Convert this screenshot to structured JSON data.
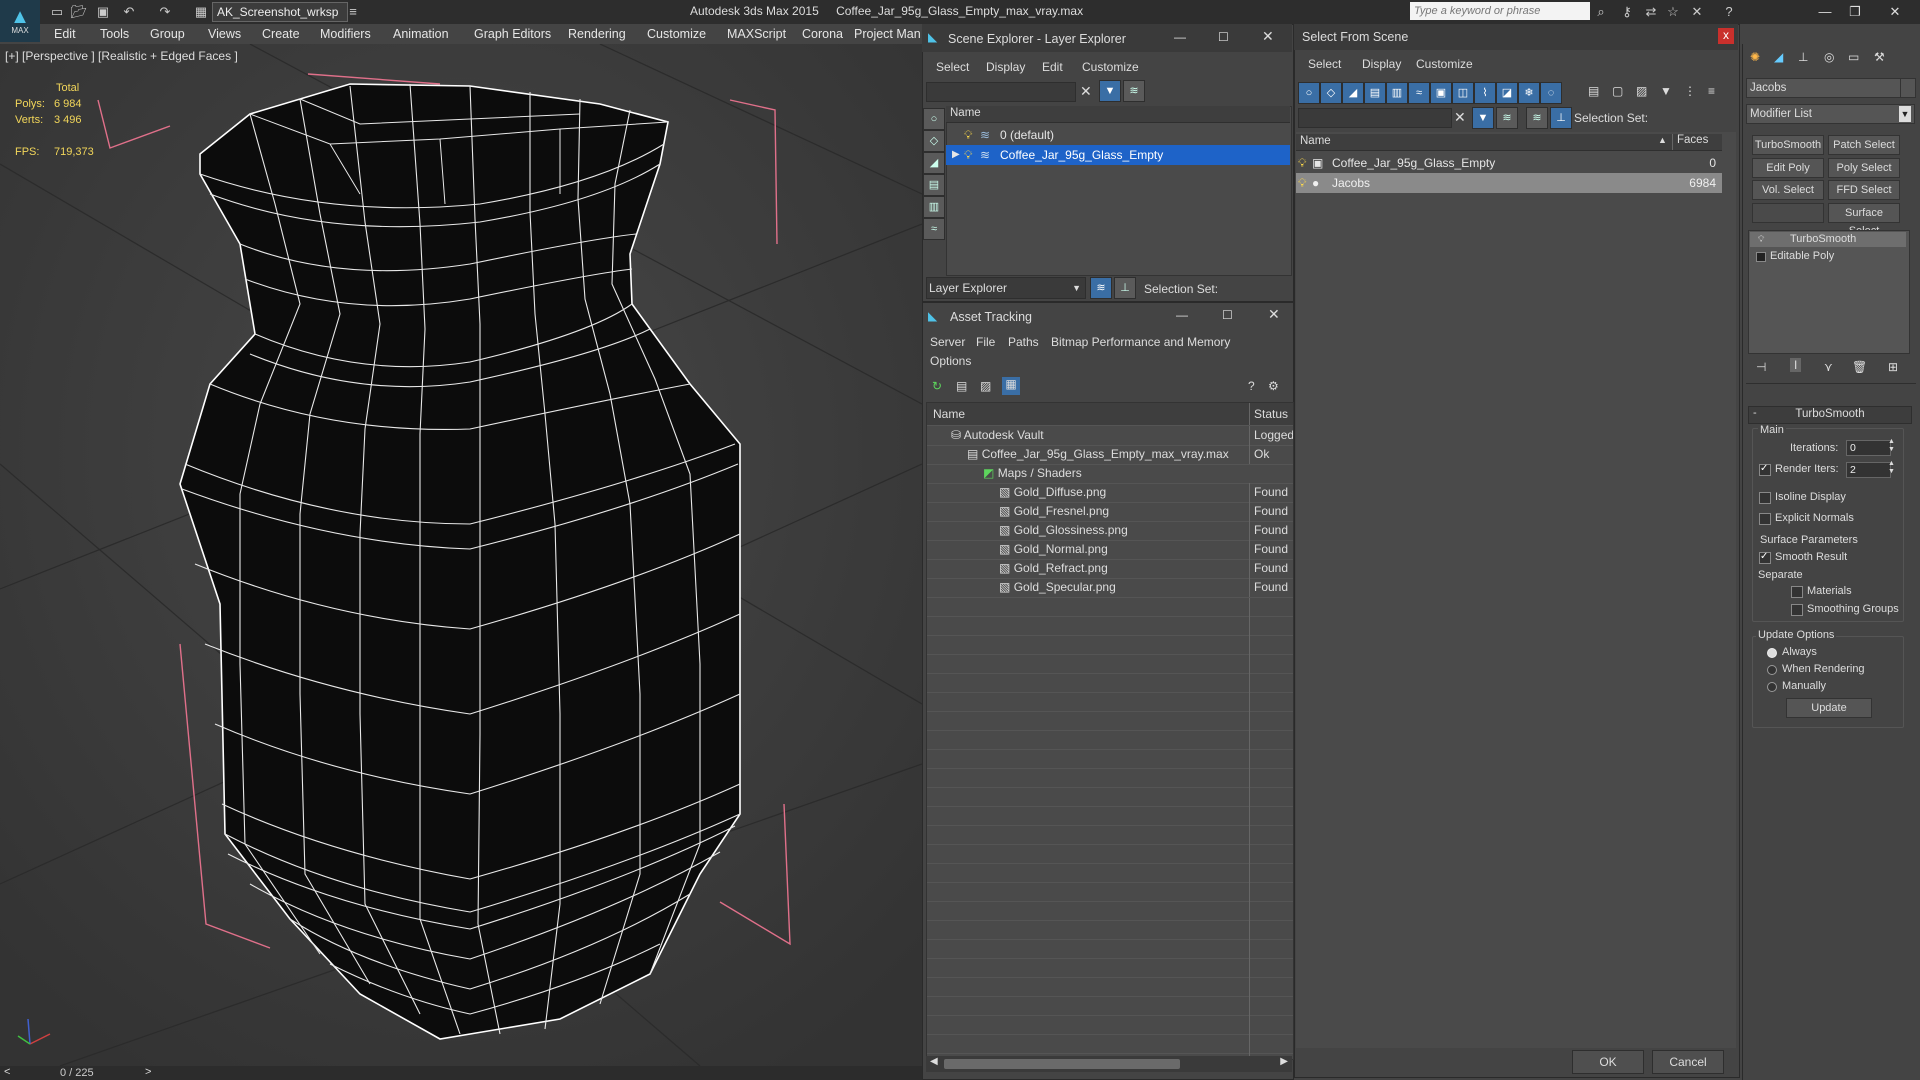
{
  "title_bar": {
    "workspace": "AK_Screenshot_wrksp",
    "app_name": "Autodesk 3ds Max  2015",
    "file_name": "Coffee_Jar_95g_Glass_Empty_max_vray.max",
    "search_placeholder": "Type a keyword or phrase",
    "logo_text": "MAX"
  },
  "menu": [
    "Edit",
    "Tools",
    "Group",
    "Views",
    "Create",
    "Modifiers",
    "Animation",
    "Graph Editors",
    "Rendering",
    "Customize",
    "MAXScript",
    "Corona",
    "Project Man"
  ],
  "viewport": {
    "label": "[+] [Perspective ] [Realistic + Edged Faces ]",
    "stats": {
      "total_label": "Total",
      "polys_label": "Polys:",
      "polys_value": "6 984",
      "verts_label": "Verts:",
      "verts_value": "3 496",
      "fps_label": "FPS:",
      "fps_value": "719,373"
    },
    "time_slider": "0 / 225"
  },
  "scene_explorer": {
    "title": "Scene Explorer - Layer Explorer",
    "menu": [
      "Select",
      "Display",
      "Edit",
      "Customize"
    ],
    "column_name": "Name",
    "rows": [
      "0 (default)",
      "Coffee_Jar_95g_Glass_Empty"
    ],
    "footer_dropdown": "Layer Explorer",
    "selection_set_label": "Selection Set:"
  },
  "asset_tracking": {
    "title": "Asset Tracking",
    "menu": [
      "Server",
      "File",
      "Paths",
      "Bitmap Performance and Memory",
      "Options"
    ],
    "columns": [
      "Name",
      "Status"
    ],
    "rows": [
      {
        "name": "Autodesk Vault",
        "status": "Logged"
      },
      {
        "name": "Coffee_Jar_95g_Glass_Empty_max_vray.max",
        "status": "Ok"
      },
      {
        "name": "Maps / Shaders",
        "status": ""
      },
      {
        "name": "Gold_Diffuse.png",
        "status": "Found"
      },
      {
        "name": "Gold_Fresnel.png",
        "status": "Found"
      },
      {
        "name": "Gold_Glossiness.png",
        "status": "Found"
      },
      {
        "name": "Gold_Normal.png",
        "status": "Found"
      },
      {
        "name": "Gold_Refract.png",
        "status": "Found"
      },
      {
        "name": "Gold_Specular.png",
        "status": "Found"
      }
    ]
  },
  "select_from_scene": {
    "title": "Select From Scene",
    "close": "x",
    "menu": [
      "Select",
      "Display",
      "Customize"
    ],
    "selection_set_label": "Selection Set:",
    "columns": [
      "Name",
      "Faces"
    ],
    "rows": [
      {
        "name": "Coffee_Jar_95g_Glass_Empty",
        "faces": "0"
      },
      {
        "name": "Jacobs",
        "faces": "6984"
      }
    ],
    "ok": "OK",
    "cancel": "Cancel"
  },
  "command_panel": {
    "object_name": "Jacobs",
    "modifier_list": "Modifier List",
    "buttons": [
      "TurboSmooth",
      "Patch Select",
      "Edit Poly",
      "Poly Select",
      "Vol. Select",
      "FFD Select",
      "Surface Select"
    ],
    "stack": [
      "TurboSmooth",
      "Editable Poly"
    ],
    "rollout_title": "TurboSmooth",
    "main_label": "Main",
    "iterations_label": "Iterations:",
    "iterations_value": "0",
    "render_iters_label": "Render Iters:",
    "render_iters_value": "2",
    "isoline_label": "Isoline Display",
    "explicit_normals_label": "Explicit Normals",
    "surface_params_label": "Surface Parameters",
    "smooth_result_label": "Smooth Result",
    "separate_label": "Separate",
    "materials_label": "Materials",
    "smoothing_groups_label": "Smoothing Groups",
    "update_options_label": "Update Options",
    "always_label": "Always",
    "when_rendering_label": "When Rendering",
    "manually_label": "Manually",
    "update_button": "Update"
  },
  "colors": {
    "selection_blue": "#1e63c8",
    "stats_yellow": "#f2d65a",
    "wire_white": "#ffffff",
    "bounding_pink": "#e0708a"
  }
}
